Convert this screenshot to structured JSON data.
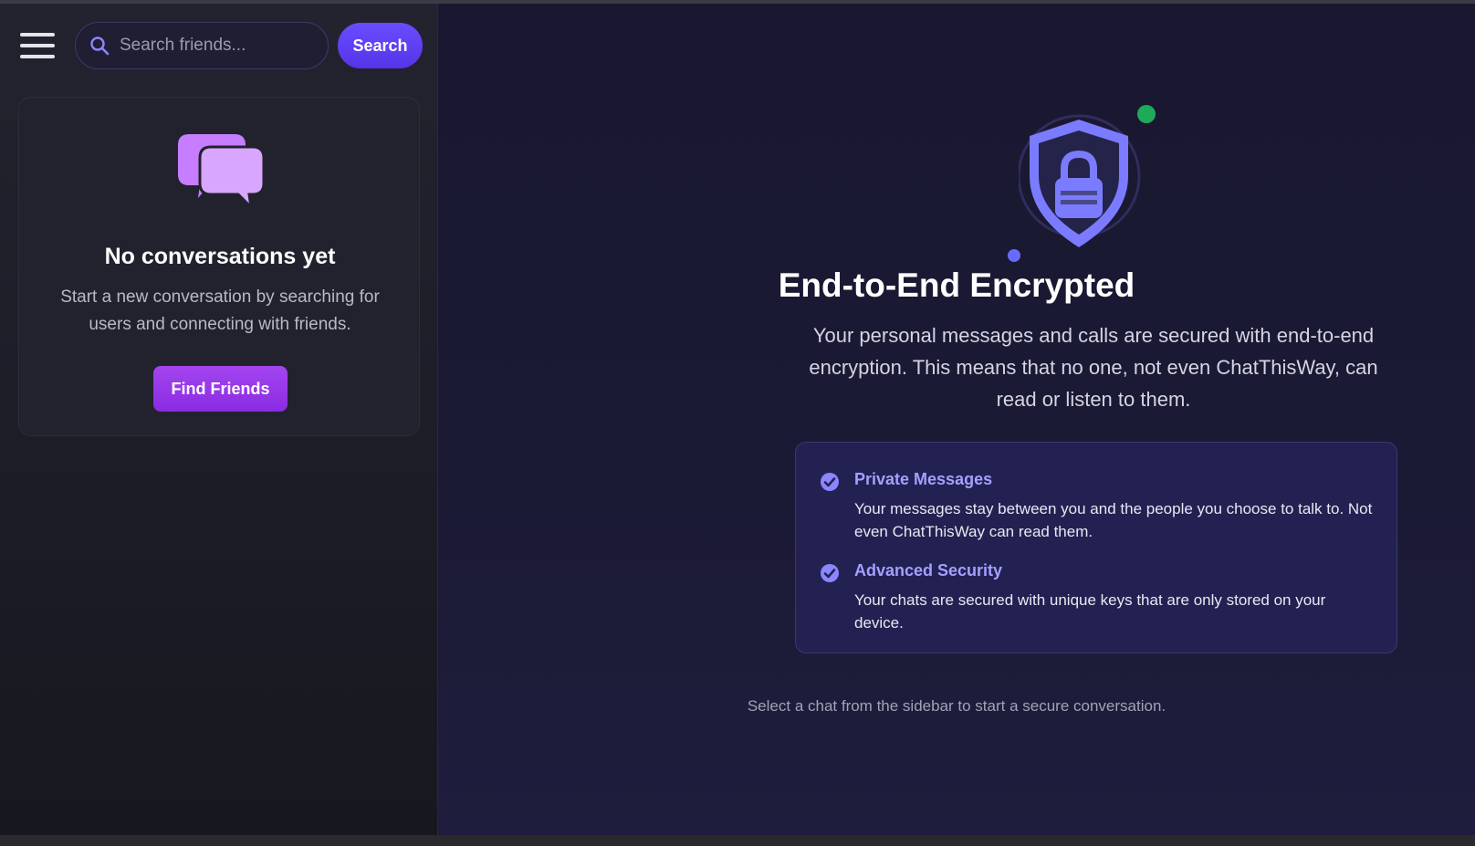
{
  "sidebar": {
    "search": {
      "placeholder": "Search friends..."
    },
    "search_button_label": "Search",
    "empty_state": {
      "title": "No conversations yet",
      "description": "Start a new conversation by searching for users and connecting with friends.",
      "button_label": "Find Friends"
    }
  },
  "main": {
    "heading": "End-to-End Encrypted",
    "intro": "Your personal messages and calls are secured with end-to-end encryption. This means that no one, not even ChatThisWay, can read or listen to them.",
    "features": [
      {
        "title": "Private Messages",
        "text": "Your messages stay between you and the people you choose to talk to. Not even ChatThisWay can read them."
      },
      {
        "title": "Advanced Security",
        "text": "Your chats are secured with unique keys that are only stored on your device."
      }
    ],
    "hint": "Select a chat from the sidebar to start a secure conversation."
  },
  "icons": {
    "menu": "hamburger-menu-icon",
    "search": "search-icon",
    "chat": "chat-bubbles-icon",
    "shield": "shield-lock-icon",
    "check": "check-circle-icon"
  },
  "colors": {
    "accent": "#6a4cff",
    "find_button": "#9b3cf0",
    "feature_title": "#a5a0ff",
    "online_dot": "#1faa59",
    "shield": "#7b7bff"
  }
}
